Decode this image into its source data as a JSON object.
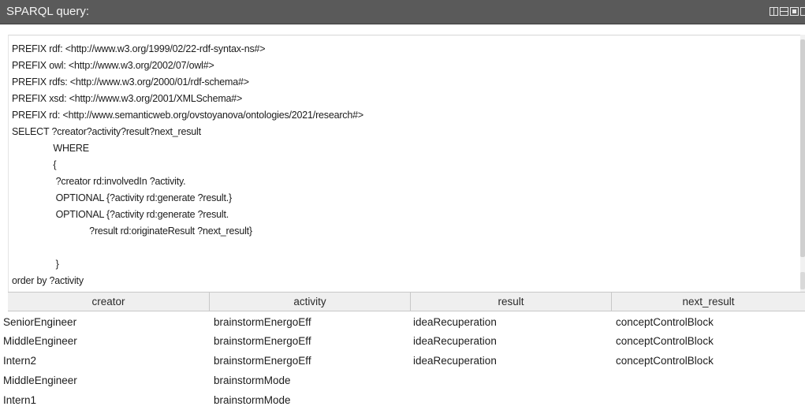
{
  "panel": {
    "title": "SPARQL query:",
    "icons": [
      "vertical-split-icon",
      "horizontal-split-icon",
      "single-pane-icon",
      "pane-icon"
    ]
  },
  "query": {
    "lines": [
      "PREFIX rdf: <http://www.w3.org/1999/02/22-rdf-syntax-ns#>",
      "PREFIX owl: <http://www.w3.org/2002/07/owl#>",
      "PREFIX rdfs: <http://www.w3.org/2000/01/rdf-schema#>",
      "PREFIX xsd: <http://www.w3.org/2001/XMLSchema#>",
      "PREFIX rd: <http://www.semanticweb.org/ovstoyanova/ontologies/2021/research#>",
      "SELECT ?creator?activity?result?next_result",
      "                WHERE",
      "                {",
      "                 ?creator rd:involvedIn ?activity.",
      "                 OPTIONAL {?activity rd:generate ?result.}",
      "                 OPTIONAL {?activity rd:generate ?result.",
      "                              ?result rd:originateResult ?next_result}",
      "",
      "                 }",
      "order by ?activity"
    ]
  },
  "results": {
    "columns": [
      "creator",
      "activity",
      "result",
      "next_result"
    ],
    "rows": [
      [
        "SeniorEngineer",
        "brainstormEnergoEff",
        "ideaRecuperation",
        "conceptControlBlock"
      ],
      [
        "MiddleEngineer",
        "brainstormEnergoEff",
        "ideaRecuperation",
        "conceptControlBlock"
      ],
      [
        "Intern2",
        "brainstormEnergoEff",
        "ideaRecuperation",
        "conceptControlBlock"
      ],
      [
        "MiddleEngineer",
        "brainstormMode",
        "",
        ""
      ],
      [
        "Intern1",
        "brainstormMode",
        "",
        ""
      ]
    ]
  }
}
